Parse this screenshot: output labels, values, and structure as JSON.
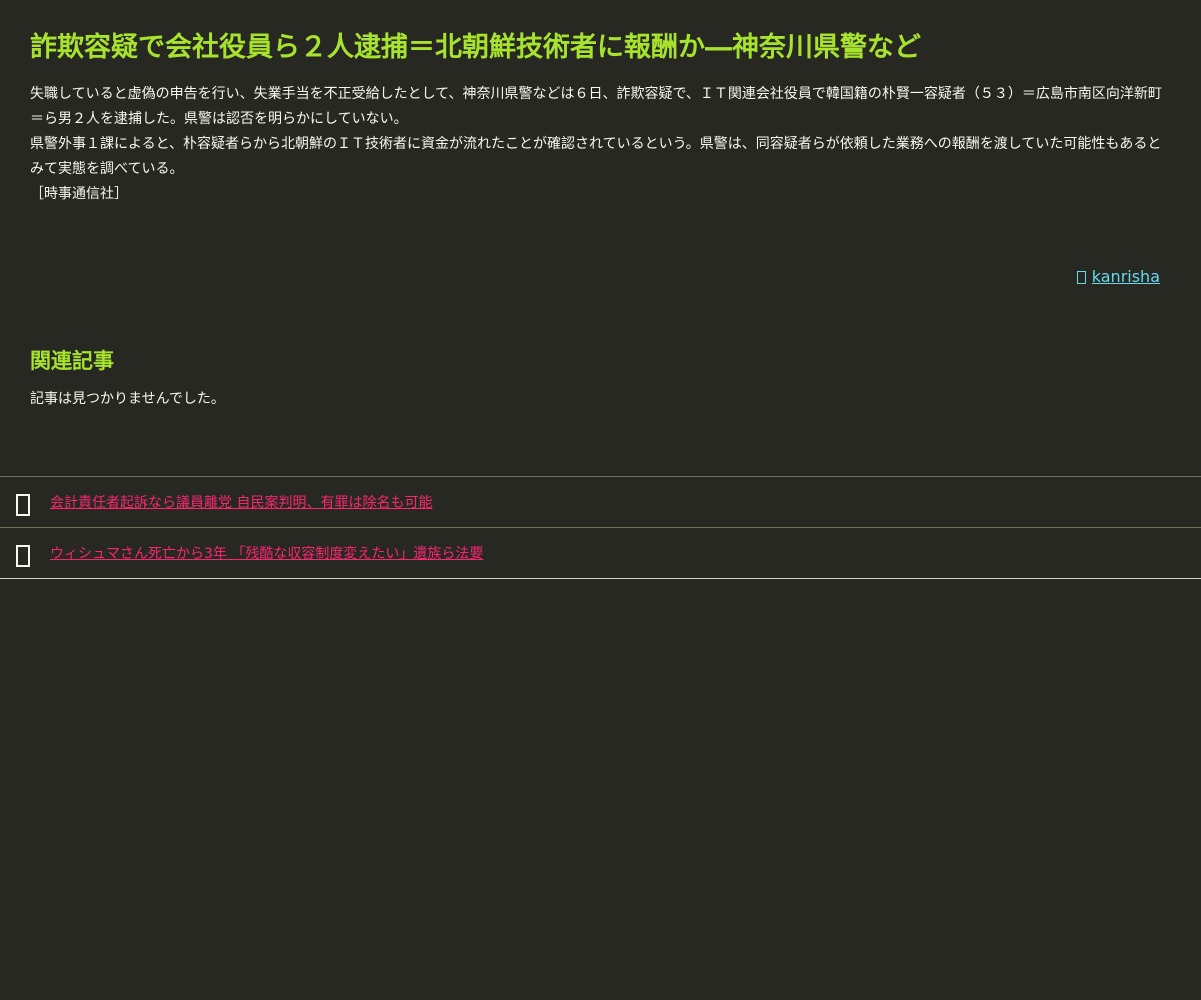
{
  "article": {
    "title": "詐欺容疑で会社役員ら２人逮捕＝北朝鮮技術者に報酬か―神奈川県警など",
    "paragraph_1": "失職していると虚偽の申告を行い、失業手当を不正受給したとして、神奈川県警などは６日、詐欺容疑で、ＩＴ関連会社役員で韓国籍の朴賢一容疑者（５３）＝広島市南区向洋新町＝ら男２人を逮捕した。県警は認否を明らかにしていない。",
    "paragraph_2": "県警外事１課によると、朴容疑者らから北朝鮮のＩＴ技術者に資金が流れたことが確認されているという。県警は、同容疑者らが依頼した業務への報酬を渡していた可能性もあるとみて実態を調べている。",
    "source": "［時事通信社］",
    "author": "kanrisha"
  },
  "related": {
    "heading": "関連記事",
    "empty_message": "記事は見つかりませんでした。"
  },
  "news_list": [
    {
      "title": "会計責任者起訴なら議員離党 自民案判明、有罪は除名も可能",
      "icon": "document-icon"
    },
    {
      "title": "ウィシュマさん死亡から3年 「残酷な収容制度変えたい」遺族ら法要",
      "icon": "document-icon"
    }
  ],
  "colors": {
    "background": "#272822",
    "title": "#a6e22e",
    "text": "#f8f8f2",
    "link": "#66d9ef",
    "news_link": "#f92672"
  }
}
